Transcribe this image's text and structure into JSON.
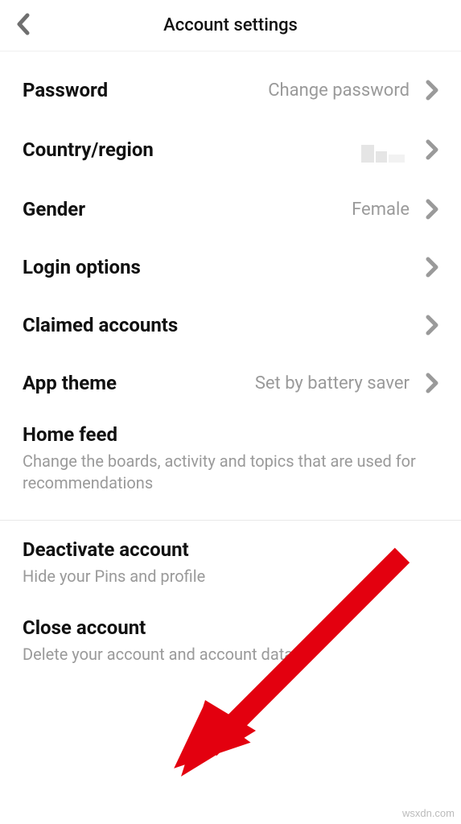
{
  "header": {
    "title": "Account settings"
  },
  "rows": {
    "password": {
      "label": "Password",
      "value": "Change password"
    },
    "country": {
      "label": "Country/region",
      "value": ""
    },
    "gender": {
      "label": "Gender",
      "value": "Female"
    },
    "login": {
      "label": "Login options",
      "value": ""
    },
    "claimed": {
      "label": "Claimed accounts",
      "value": ""
    },
    "theme": {
      "label": "App theme",
      "value": "Set by battery saver"
    }
  },
  "homefeed": {
    "title": "Home feed",
    "desc": "Change the boards, activity and topics that are used for recommendations"
  },
  "deactivate": {
    "title": "Deactivate account",
    "desc": "Hide your Pins and profile"
  },
  "close": {
    "title": "Close account",
    "desc": "Delete your account and account data"
  },
  "watermark": "wsxdn.com"
}
